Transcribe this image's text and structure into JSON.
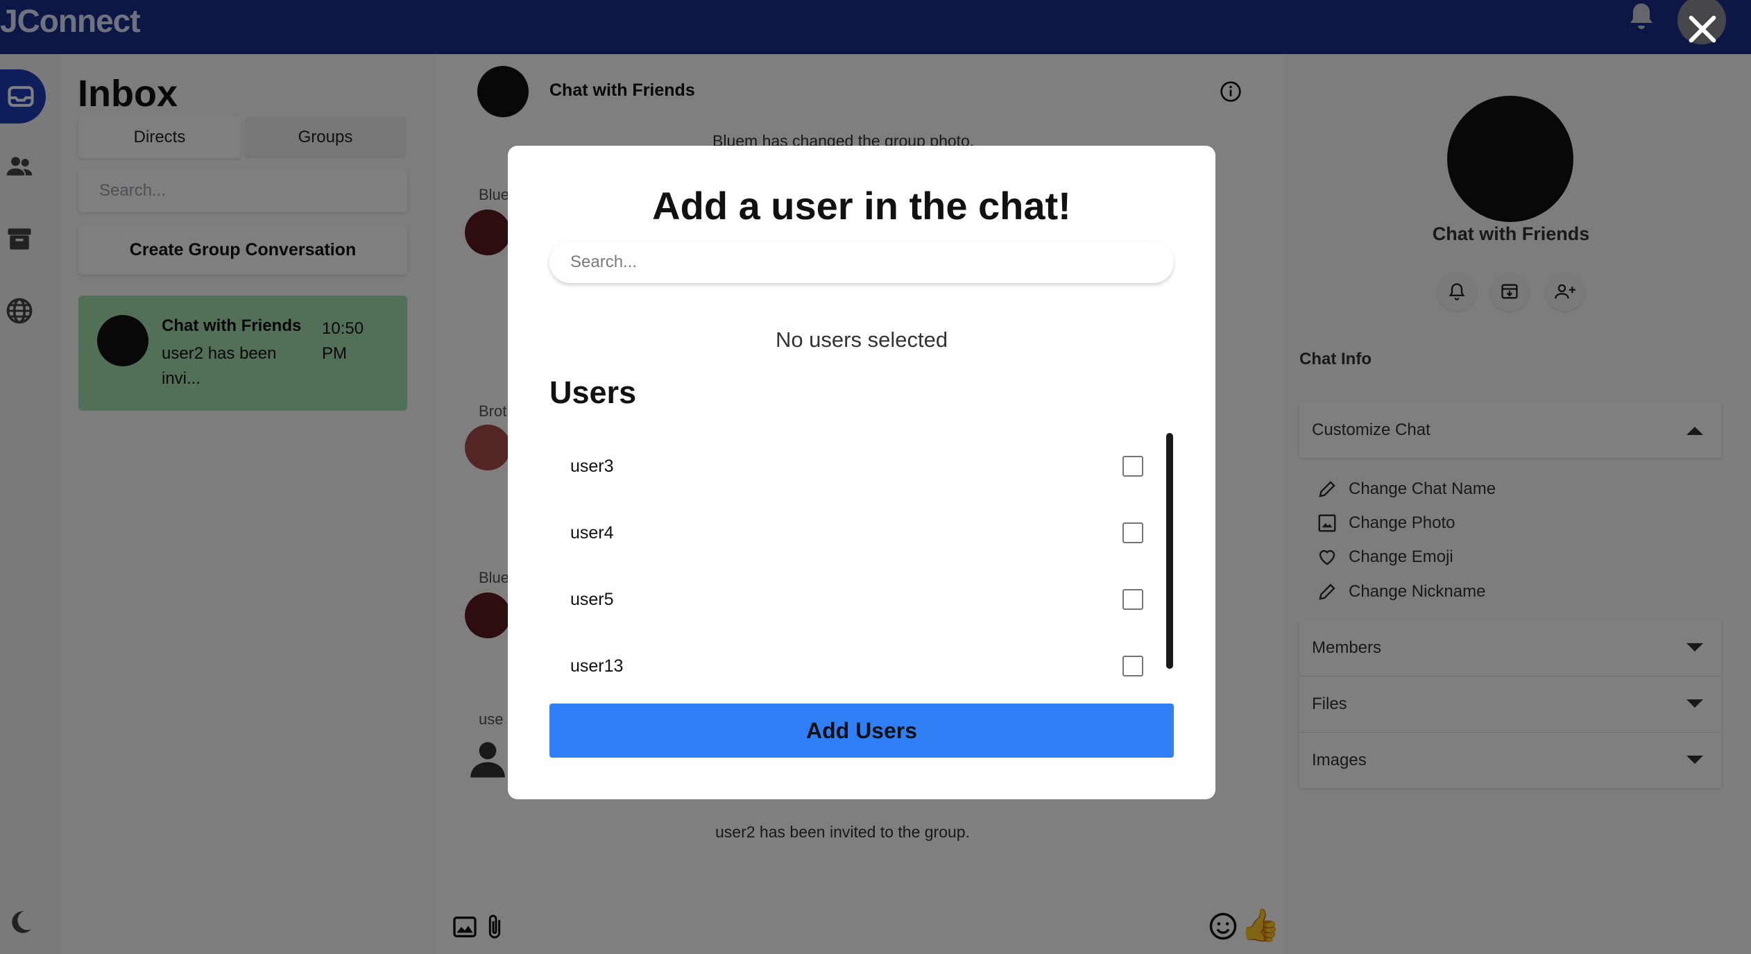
{
  "app": {
    "brand": "JConnect"
  },
  "sidebar": {
    "title": "Inbox",
    "tabs": [
      {
        "label": "Directs"
      },
      {
        "label": "Groups"
      }
    ],
    "search_placeholder": "Search...",
    "create_group_label": "Create Group Conversation",
    "conversations": [
      {
        "name": "Chat with Friends",
        "time": "10:50 PM",
        "preview": "user2 has been invi..."
      }
    ]
  },
  "chat": {
    "title": "Chat with Friends",
    "messages": [
      {
        "type": "system",
        "text": "Bluem has changed the group photo."
      },
      {
        "type": "sender",
        "name": "Blue"
      },
      {
        "type": "sender",
        "name": "Brot"
      },
      {
        "type": "sender",
        "name": "Blue"
      },
      {
        "type": "sender",
        "name": "use"
      },
      {
        "type": "system",
        "text": "user2 has been invited to the group."
      }
    ]
  },
  "info_panel": {
    "name": "Chat with Friends",
    "section_label": "Chat Info",
    "customize": {
      "label": "Customize Chat",
      "items": [
        {
          "label": "Change Chat Name",
          "icon": "pencil-icon"
        },
        {
          "label": "Change Photo",
          "icon": "image-icon"
        },
        {
          "label": "Change Emoji",
          "icon": "heart-icon"
        },
        {
          "label": "Change Nickname",
          "icon": "pencil-icon"
        }
      ]
    },
    "accordions": [
      {
        "label": "Members"
      },
      {
        "label": "Files"
      },
      {
        "label": "Images"
      }
    ]
  },
  "modal": {
    "title": "Add a user in the chat!",
    "search_placeholder": "Search...",
    "status": "No users selected",
    "users_heading": "Users",
    "users": [
      {
        "name": "user3",
        "checked": false
      },
      {
        "name": "user4",
        "checked": false
      },
      {
        "name": "user5",
        "checked": false
      },
      {
        "name": "user13",
        "checked": false
      }
    ],
    "submit_label": "Add Users"
  },
  "colors": {
    "topbar": "#1a2f8a",
    "conversation_active": "#a5dfb0",
    "primary_button": "#2f80f7"
  }
}
